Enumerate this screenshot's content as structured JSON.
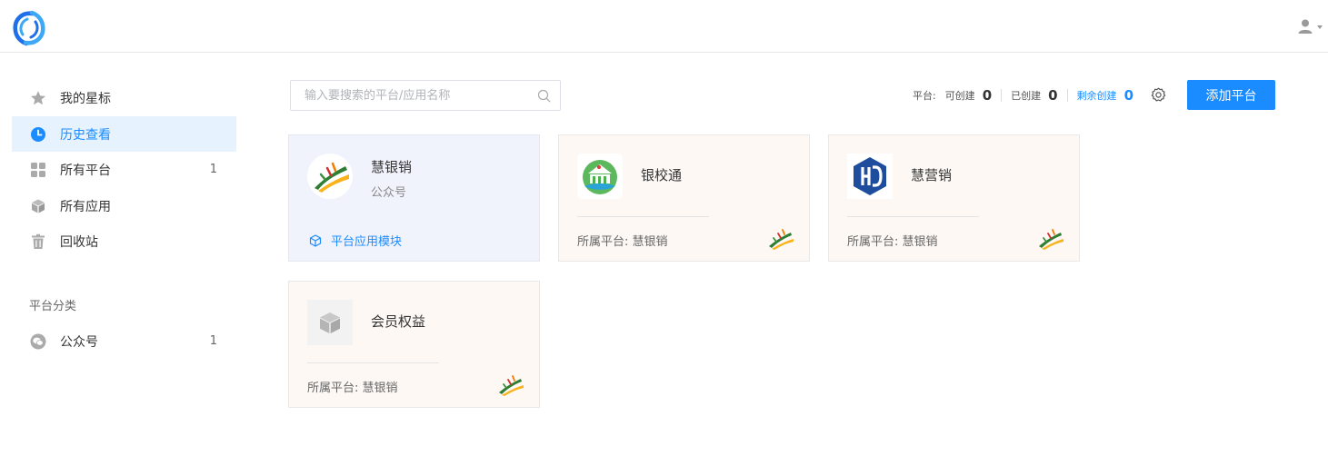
{
  "sidebar": {
    "items": [
      {
        "label": "我的星标",
        "icon": "star-icon",
        "count": ""
      },
      {
        "label": "历史查看",
        "icon": "clock-icon",
        "count": "",
        "active": true
      },
      {
        "label": "所有平台",
        "icon": "grid-icon",
        "count": "1"
      },
      {
        "label": "所有应用",
        "icon": "cube-icon",
        "count": ""
      },
      {
        "label": "回收站",
        "icon": "trash-icon",
        "count": ""
      }
    ],
    "category_title": "平台分类",
    "categories": [
      {
        "label": "公众号",
        "icon": "wechat-icon",
        "count": "1"
      }
    ]
  },
  "search": {
    "placeholder": "输入要搜索的平台/应用名称",
    "value": ""
  },
  "stats": {
    "platform_label": "平台:",
    "can_create_label": "可创建",
    "can_create_value": "0",
    "created_label": "已创建",
    "created_value": "0",
    "remaining_label": "剩余创建",
    "remaining_value": "0"
  },
  "add_button": "添加平台",
  "cards": [
    {
      "title": "慧银销",
      "subtitle": "公众号",
      "module_label": "平台应用模块",
      "logo": "huiyinxiao-logo"
    },
    {
      "title": "银校通",
      "platform_label": "所属平台:",
      "platform_value": "慧银销",
      "logo": "yinxiaotong-logo"
    },
    {
      "title": "慧营销",
      "platform_label": "所属平台:",
      "platform_value": "慧银销",
      "logo": "huiyingxiao-logo"
    },
    {
      "title": "会员权益",
      "platform_label": "所属平台:",
      "platform_value": "慧银销",
      "logo": "cube-placeholder"
    }
  ],
  "colors": {
    "accent": "#1a8cff",
    "active_bg": "#e6f2fd",
    "card_bg": "#fdf8f4",
    "card_highlight_bg": "#f1f3fc"
  }
}
